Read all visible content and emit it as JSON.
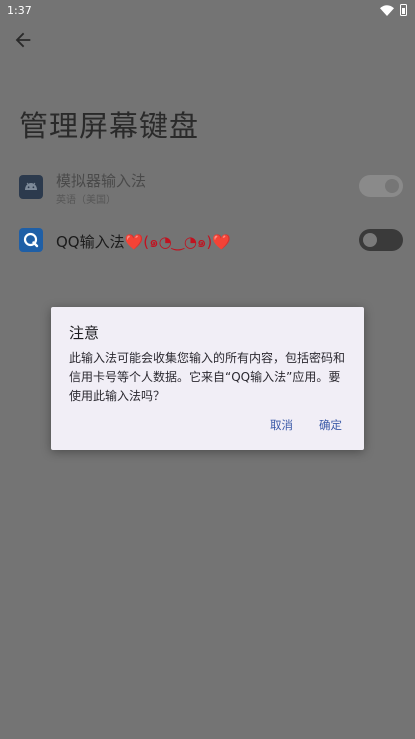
{
  "status_bar": {
    "time": "1:37"
  },
  "page": {
    "title": "管理屏幕键盘"
  },
  "keyboards": [
    {
      "name": "模拟器输入法",
      "subtitle": "英语（美国）",
      "enabled": true,
      "icon": "android-icon"
    },
    {
      "name": "QQ输入法",
      "name_suffix": "❤️(๑◔‿◔๑)❤️",
      "enabled": false,
      "icon": "qq-icon"
    }
  ],
  "dialog": {
    "title": "注意",
    "message": "此输入法可能会收集您输入的所有内容，包括密码和信用卡号等个人数据。它来自“QQ输入法”应用。要使用此输入法吗？",
    "cancel_label": "取消",
    "ok_label": "确定"
  },
  "colors": {
    "scrim_background": "#747474",
    "dialog_background": "#f1eef6",
    "button_text": "#3b5aa8"
  }
}
